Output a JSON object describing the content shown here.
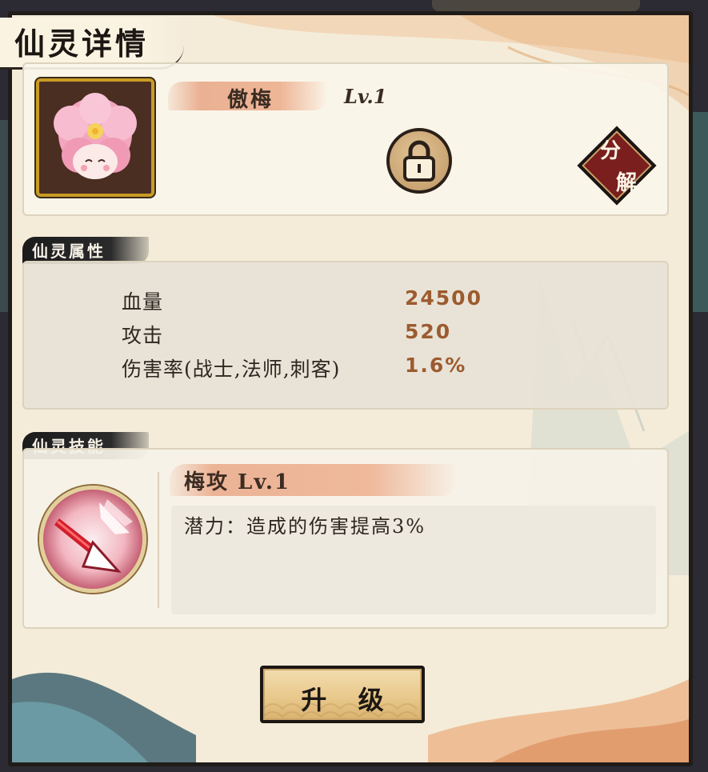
{
  "window": {
    "title": "仙灵详情"
  },
  "spirit": {
    "name": "傲梅",
    "level": "Lv.1"
  },
  "actions": {
    "decompose_char_1": "分",
    "decompose_char_2": "解",
    "upgrade_label": "升 级"
  },
  "attributes": {
    "section_title": "仙灵属性",
    "rows": [
      {
        "label": "血量",
        "value": "24500"
      },
      {
        "label": "攻击",
        "value": "520"
      },
      {
        "label": "伤害率(战士,法师,刺客)",
        "value": "1.6%"
      }
    ]
  },
  "skills": {
    "section_title": "仙灵技能",
    "items": [
      {
        "name": "梅攻 Lv.1",
        "description": "潜力：造成的伤害提高3%"
      }
    ]
  },
  "icons": {
    "avatar": "cherry-blossom-spirit-icon",
    "lock": "lock-icon",
    "skill": "arrow-strike-icon"
  },
  "colors": {
    "panel_bg": "#f4ecd9",
    "stat_value": "#9c5b2f",
    "avatar_border": "#c99b25",
    "decompose_bg": "#7a1e1e",
    "button_gold": "#e9c98c"
  }
}
